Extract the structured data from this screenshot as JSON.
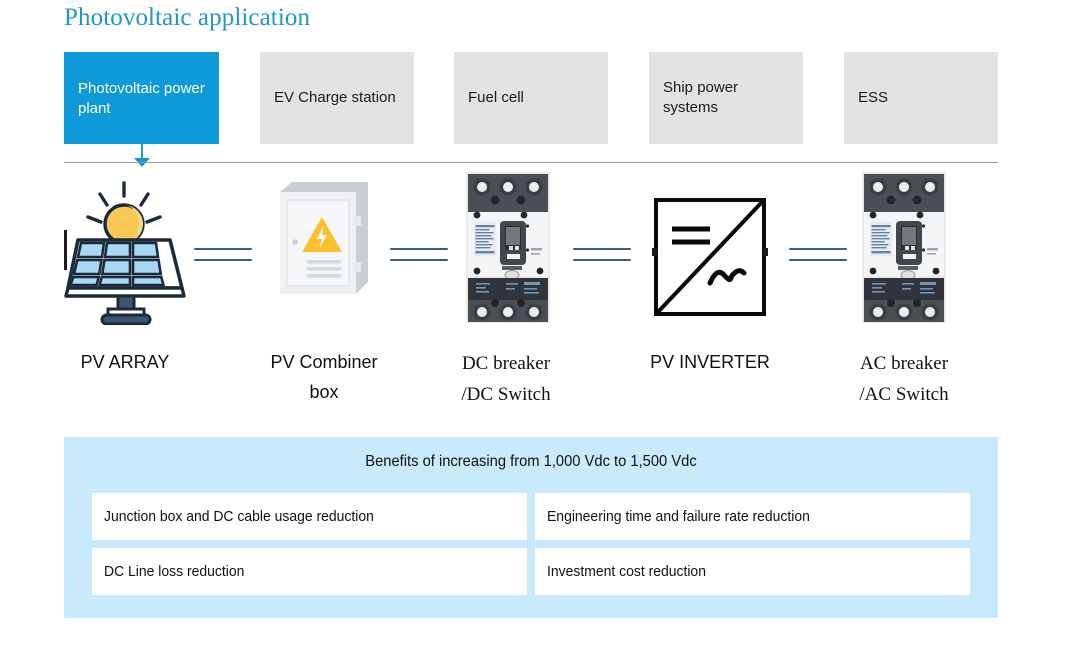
{
  "header": {
    "title": "Photovoltaic application"
  },
  "tabs": {
    "items": [
      {
        "label": "Photovoltaic power plant",
        "active": true
      },
      {
        "label": "EV Charge station",
        "active": false
      },
      {
        "label": "Fuel cell",
        "active": false
      },
      {
        "label": "Ship power systems",
        "active": false
      },
      {
        "label": "ESS",
        "active": false
      }
    ],
    "active_color": "#0E9AD8",
    "inactive_color": "#E3E3E3"
  },
  "flow": {
    "nodes": [
      {
        "icon": "solar-panel-icon",
        "label": "PV ARRAY",
        "font": "sans"
      },
      {
        "icon": "combiner-box-icon",
        "label": "PV Combiner box",
        "font": "sans"
      },
      {
        "icon": "circuit-breaker-icon",
        "label": "DC breaker /DC Switch",
        "font": "serif"
      },
      {
        "icon": "inverter-symbol-icon",
        "label": "PV INVERTER",
        "font": "sans"
      },
      {
        "icon": "circuit-breaker-icon",
        "label": "AC breaker /AC Switch",
        "font": "serif"
      }
    ],
    "labels": {
      "pv_array": "PV ARRAY",
      "pv_combiner_line1": "PV Combiner",
      "pv_combiner_line2": "box",
      "dc_breaker_line1": "DC breaker",
      "dc_breaker_line2": "/DC Switch",
      "pv_inverter": "PV INVERTER",
      "ac_breaker_line1": "AC breaker",
      "ac_breaker_line2": "/AC Switch"
    },
    "connector_color": "#3F5E74"
  },
  "benefits": {
    "title": "Benefits of increasing from 1,000 Vdc to 1,500 Vdc",
    "panel_color": "#C8EAFA",
    "items": [
      "Junction box and DC cable usage reduction",
      "Engineering time and failure rate reduction",
      "DC Line loss reduction",
      "Investment cost reduction"
    ]
  }
}
